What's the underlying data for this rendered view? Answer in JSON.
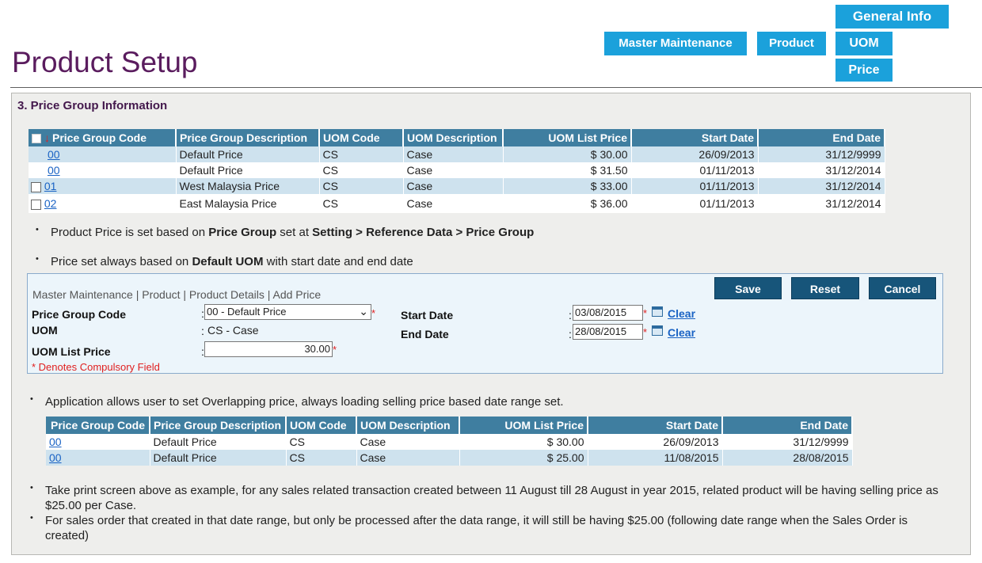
{
  "nav": {
    "general_info": "General Info",
    "master_maintenance": "Master Maintenance",
    "product": "Product",
    "uom": "UOM",
    "price": "Price"
  },
  "page_title": "Product Setup",
  "section_title": "3. Price Group Information",
  "table1": {
    "headers": [
      "Price Group Code",
      "Price Group Description",
      "UOM Code",
      "UOM Description",
      "UOM List Price",
      "Start Date",
      "End Date"
    ],
    "rows": [
      [
        "00",
        "Default Price",
        "CS",
        "Case",
        "$ 30.00",
        "26/09/2013",
        "31/12/9999"
      ],
      [
        "00",
        "Default Price",
        "CS",
        "Case",
        "$ 31.50",
        "01/11/2013",
        "31/12/2014"
      ],
      [
        "01",
        "West Malaysia Price",
        "CS",
        "Case",
        "$ 33.00",
        "01/11/2013",
        "31/12/2014"
      ],
      [
        "02",
        "East Malaysia Price",
        "CS",
        "Case",
        "$ 36.00",
        "01/11/2013",
        "31/12/2014"
      ]
    ]
  },
  "bullets1": {
    "b1_pre": "Product Price is set based on ",
    "b1_bold1": "Price Group",
    "b1_mid": " set at ",
    "b1_bold2": "Setting > Reference Data > Price Group",
    "b2_pre": "Price set always based on ",
    "b2_bold": "Default UOM",
    "b2_post": " with start date and end date"
  },
  "form": {
    "breadcrumb": "Master Maintenance | Product | Product Details | Add Price",
    "save": "Save",
    "reset": "Reset",
    "cancel": "Cancel",
    "price_group_code_label": "Price Group Code",
    "price_group_code_value": "00 - Default Price",
    "uom_label": "UOM",
    "uom_value": "CS - Case",
    "uom_list_price_label": "UOM List Price",
    "uom_list_price_value": "30.00",
    "start_date_label": "Start Date",
    "start_date_value": "03/08/2015",
    "end_date_label": "End Date",
    "end_date_value": "28/08/2015",
    "clear": "Clear",
    "compulsory_note": "* Denotes Compulsory Field",
    "colon": ":",
    "asterisk": "*"
  },
  "bullet3": "Application allows user to set Overlapping price, always loading selling price based date range set.",
  "table2": {
    "headers": [
      "Price Group Code",
      "Price Group Description",
      "UOM Code",
      "UOM Description",
      "UOM List Price",
      "Start Date",
      "End Date"
    ],
    "rows": [
      [
        "00",
        "Default Price",
        "CS",
        "Case",
        "$ 30.00",
        "26/09/2013",
        "31/12/9999"
      ],
      [
        "00",
        "Default Price",
        "CS",
        "Case",
        "$ 25.00",
        "11/08/2015",
        "28/08/2015"
      ]
    ]
  },
  "bullet4": "Take print screen above as example, for any sales related transaction created between 11 August till 28 August in year 2015, related product will be having selling price as $25.00 per Case.",
  "bullet5": "For sales order that created in that date range, but only be processed after the data range, it will still be having $25.00 (following date range when the Sales Order is created)",
  "bullet_char": "•",
  "colors": {
    "nav_blue": "#1ba1db",
    "title_purple": "#5a1c5e",
    "table_header": "#3f7ea0",
    "row_blue": "#cee2ee",
    "button_dark": "#17557a",
    "required_red": "#e02020"
  }
}
